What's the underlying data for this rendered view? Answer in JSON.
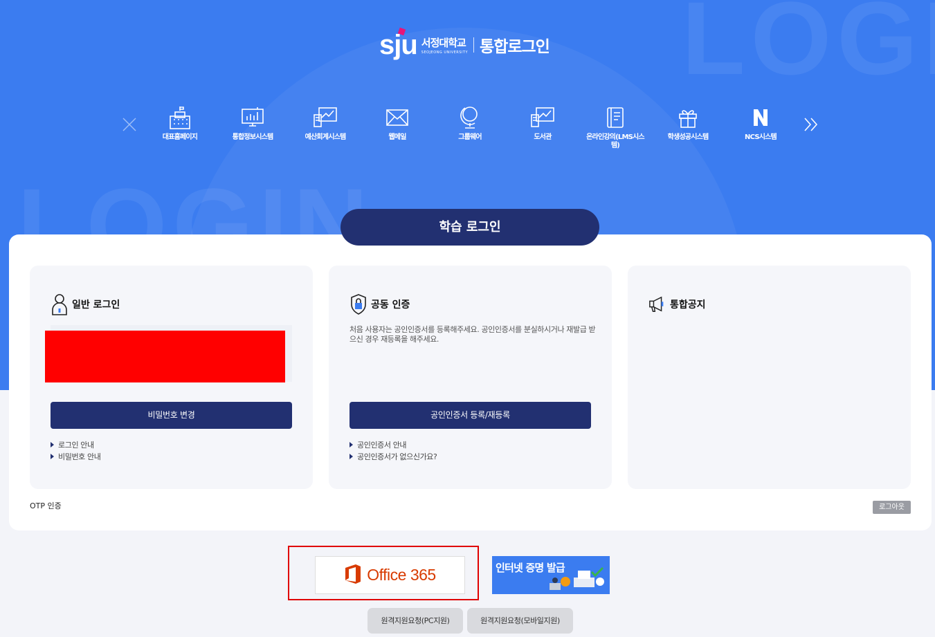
{
  "brand": {
    "logo_mark": "sju",
    "university_kr": "서정대학교",
    "university_en": "SEOJEONG UNIVERSITY",
    "page_title": "통합로그인",
    "accent": "#e6157a",
    "primary": "#223071",
    "hero_color": "#3b7cf0"
  },
  "background_text": {
    "top": "LOGIN",
    "left": "LOGIN"
  },
  "quick_menu": {
    "prev_icon": "close-icon",
    "next_icon": "double-chevron-right-icon",
    "items": [
      {
        "label": "대표홈페이지",
        "icon": "building-icon"
      },
      {
        "label": "통합정보시스템",
        "icon": "monitor-chart-icon"
      },
      {
        "label": "예산회계시스템",
        "icon": "computer-chart-icon"
      },
      {
        "label": "웹메일",
        "icon": "mail-icon"
      },
      {
        "label": "그룹웨어",
        "icon": "globe-icon"
      },
      {
        "label": "도서관",
        "icon": "library-icon"
      },
      {
        "label": "온라인강의(LMS시스템)",
        "icon": "book-icon"
      },
      {
        "label": "학생성공시스템",
        "icon": "gift-icon"
      },
      {
        "label": "NCS시스템",
        "icon": "ncs-logo-icon"
      }
    ]
  },
  "login_tab": {
    "label": "학습 로그인"
  },
  "cards": {
    "general": {
      "title": "일반 로그인",
      "icon": "user-icon",
      "button": "비밀번호 변경",
      "links": [
        "로그인 안내",
        "비밀번호 안내"
      ]
    },
    "certificate": {
      "title": "공동 인증",
      "icon": "shield-lock-icon",
      "description": "처음 사용자는 공인인증서를 등록해주세요. 공인인증서를 분실하시거나 재발급 받으신 경우 재등록을 해주세요.",
      "button": "공인인증서 등록/재등록",
      "links": [
        "공인인증서 안내",
        "공인인증서가 없으신가요?"
      ]
    },
    "notice": {
      "title": "통합공지",
      "icon": "megaphone-icon"
    }
  },
  "otp_label": "OTP 인증",
  "logout_label": "로그아웃",
  "banners": {
    "office": "Office 365",
    "certificate": "인터넷 증명 발급"
  },
  "remote_support": {
    "pc": "원격지원요청(PC지원)",
    "mobile": "원격지원요청(모바일지원)"
  }
}
